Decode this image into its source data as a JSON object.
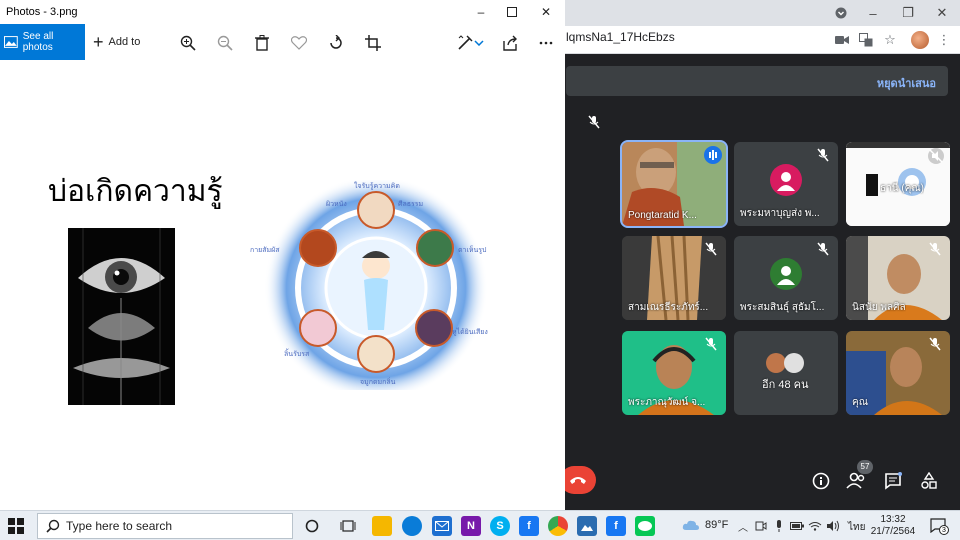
{
  "chrome": {
    "url_fragment": "lqmsNa1_17HcEbzs",
    "win_minimize": "–",
    "win_restore": "❐",
    "win_close": "✕"
  },
  "meet": {
    "banner_link": "หยุดนำเสนอ",
    "tiles": [
      {
        "name": "Pongtaratid K...",
        "type": "video",
        "active": true
      },
      {
        "name": "พระมหาบุญส่ง พ...",
        "type": "avatar",
        "avatar_color": "#d81b60"
      },
      {
        "name": "ธานี (คุณ)",
        "type": "presentation"
      },
      {
        "name": "สามเณรธีระภัทร์...",
        "type": "video"
      },
      {
        "name": "พระสมสินธุ์ สุธัมโ...",
        "type": "avatar",
        "avatar_color": "#2e7d32"
      },
      {
        "name": "นิสนัย พลศิล",
        "type": "video"
      },
      {
        "name": "พระภาณุวัฒน์ จ...",
        "type": "video"
      },
      {
        "name": "อีก 48 คน",
        "type": "others"
      },
      {
        "name": "คุณ",
        "type": "video"
      }
    ],
    "people_count": "57",
    "colors": {
      "bg": "#202124",
      "tile": "#3c4043",
      "end_call": "#ea4335",
      "link": "#8ab4f8"
    }
  },
  "photos": {
    "title": "Photos - 3.png",
    "see_all": "See all photos",
    "add_to": "Add to",
    "slide_title": "บ่อเกิดความรู้",
    "wheel_labels": [
      "ใจรับรู้ความคิด",
      "ศีลธรรม",
      "ผิวหนัง",
      "ตาเห็นรูป",
      "หูได้ยินเสียง",
      "จมูกดมกลิ่น",
      "ลิ้นรับรส",
      "กายสัมผัส"
    ],
    "accent": "#0078d7"
  },
  "taskbar": {
    "search_placeholder": "Type here to search",
    "weather": "89°F",
    "lang": "ไทย",
    "time": "13:32",
    "date": "21/7/2564",
    "notif_count": "3"
  }
}
